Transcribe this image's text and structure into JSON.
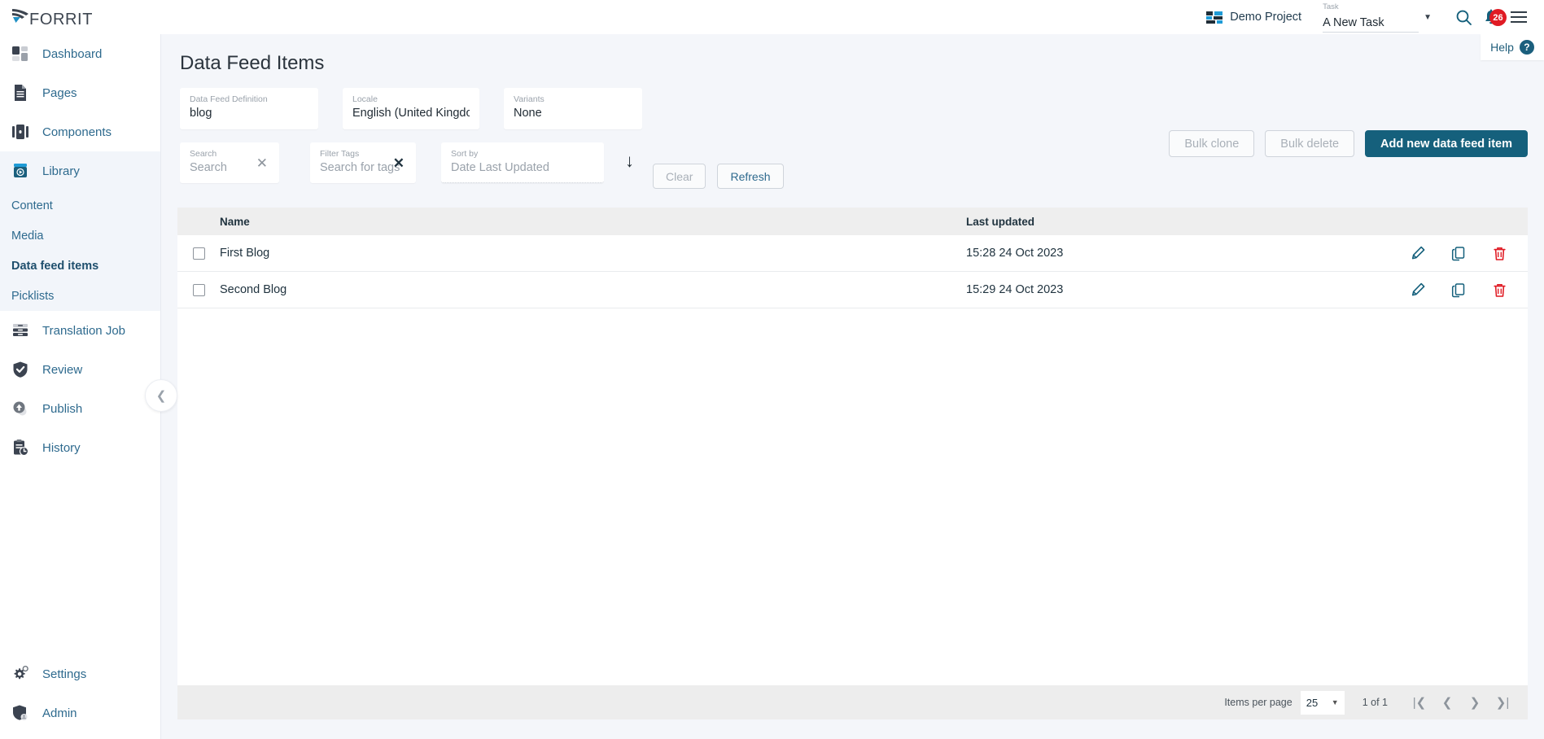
{
  "brand": {
    "name": "FORRIT",
    "accent": "#15607c",
    "logo_icon": "forrit-swoosh-icon"
  },
  "topbar": {
    "project_icon": "project-grid-icon",
    "project_name": "Demo Project",
    "task_label": "Task",
    "task_value": "A New Task",
    "task_caret_icon": "chevron-down-icon",
    "search_icon": "search-icon",
    "notifications_icon": "bell-icon",
    "notifications_count": "26",
    "menu_icon": "hamburger-menu-icon",
    "help_label": "Help",
    "help_icon": "question-mark-icon"
  },
  "sidebar": {
    "collapse_icon": "chevron-left-icon",
    "items": [
      {
        "label": "Dashboard",
        "icon": "dashboard-grid-icon"
      },
      {
        "label": "Pages",
        "icon": "page-document-icon"
      },
      {
        "label": "Components",
        "icon": "components-columns-icon"
      },
      {
        "label": "Library",
        "icon": "library-play-icon"
      },
      {
        "label": "Translation Job",
        "icon": "translation-stack-icon"
      },
      {
        "label": "Review",
        "icon": "shield-check-icon"
      },
      {
        "label": "Publish",
        "icon": "publish-upload-icon"
      },
      {
        "label": "History",
        "icon": "history-clipboard-clock-icon"
      }
    ],
    "library_children": [
      {
        "label": "Content",
        "active": false
      },
      {
        "label": "Media",
        "active": false
      },
      {
        "label": "Data feed items",
        "active": true
      },
      {
        "label": "Picklists",
        "active": false
      }
    ],
    "bottom_items": [
      {
        "label": "Settings",
        "icon": "gear-icon"
      },
      {
        "label": "Admin",
        "icon": "shield-admin-icon"
      }
    ]
  },
  "page": {
    "title": "Data Feed Items"
  },
  "filters": {
    "data_feed_definition": {
      "label": "Data Feed Definition",
      "value": "blog"
    },
    "locale": {
      "label": "Locale",
      "value": "English (United Kingdom) - en-"
    },
    "variants": {
      "label": "Variants",
      "value": "None"
    },
    "search": {
      "label": "Search",
      "placeholder": "Search",
      "value": "",
      "clear_icon": "close-x-icon"
    },
    "filter_tags": {
      "label": "Filter Tags",
      "placeholder": "Search for tags",
      "value": "",
      "clear_icon": "close-x-icon"
    },
    "sort_by": {
      "label": "Sort by",
      "value": "Date Last Updated",
      "direction_icon": "arrow-down-icon"
    },
    "clear_button": "Clear",
    "refresh_button": "Refresh"
  },
  "actions": {
    "bulk_clone": "Bulk clone",
    "bulk_delete": "Bulk delete",
    "add_new": "Add new data feed item"
  },
  "table": {
    "columns": [
      "Name",
      "Last updated"
    ],
    "rows": [
      {
        "name": "First Blog",
        "last_updated": "15:28 24 Oct 2023"
      },
      {
        "name": "Second Blog",
        "last_updated": "15:29 24 Oct 2023"
      }
    ],
    "row_actions": [
      "edit-pencil-icon",
      "copy-duplicate-icon",
      "delete-trash-icon"
    ],
    "delete_color": "#e01b24"
  },
  "pagination": {
    "items_per_page_label": "Items per page",
    "items_per_page_value": "25",
    "range": "1 of 1",
    "first_icon": "first-page-icon",
    "prev_icon": "previous-page-icon",
    "next_icon": "next-page-icon",
    "last_icon": "last-page-icon"
  }
}
